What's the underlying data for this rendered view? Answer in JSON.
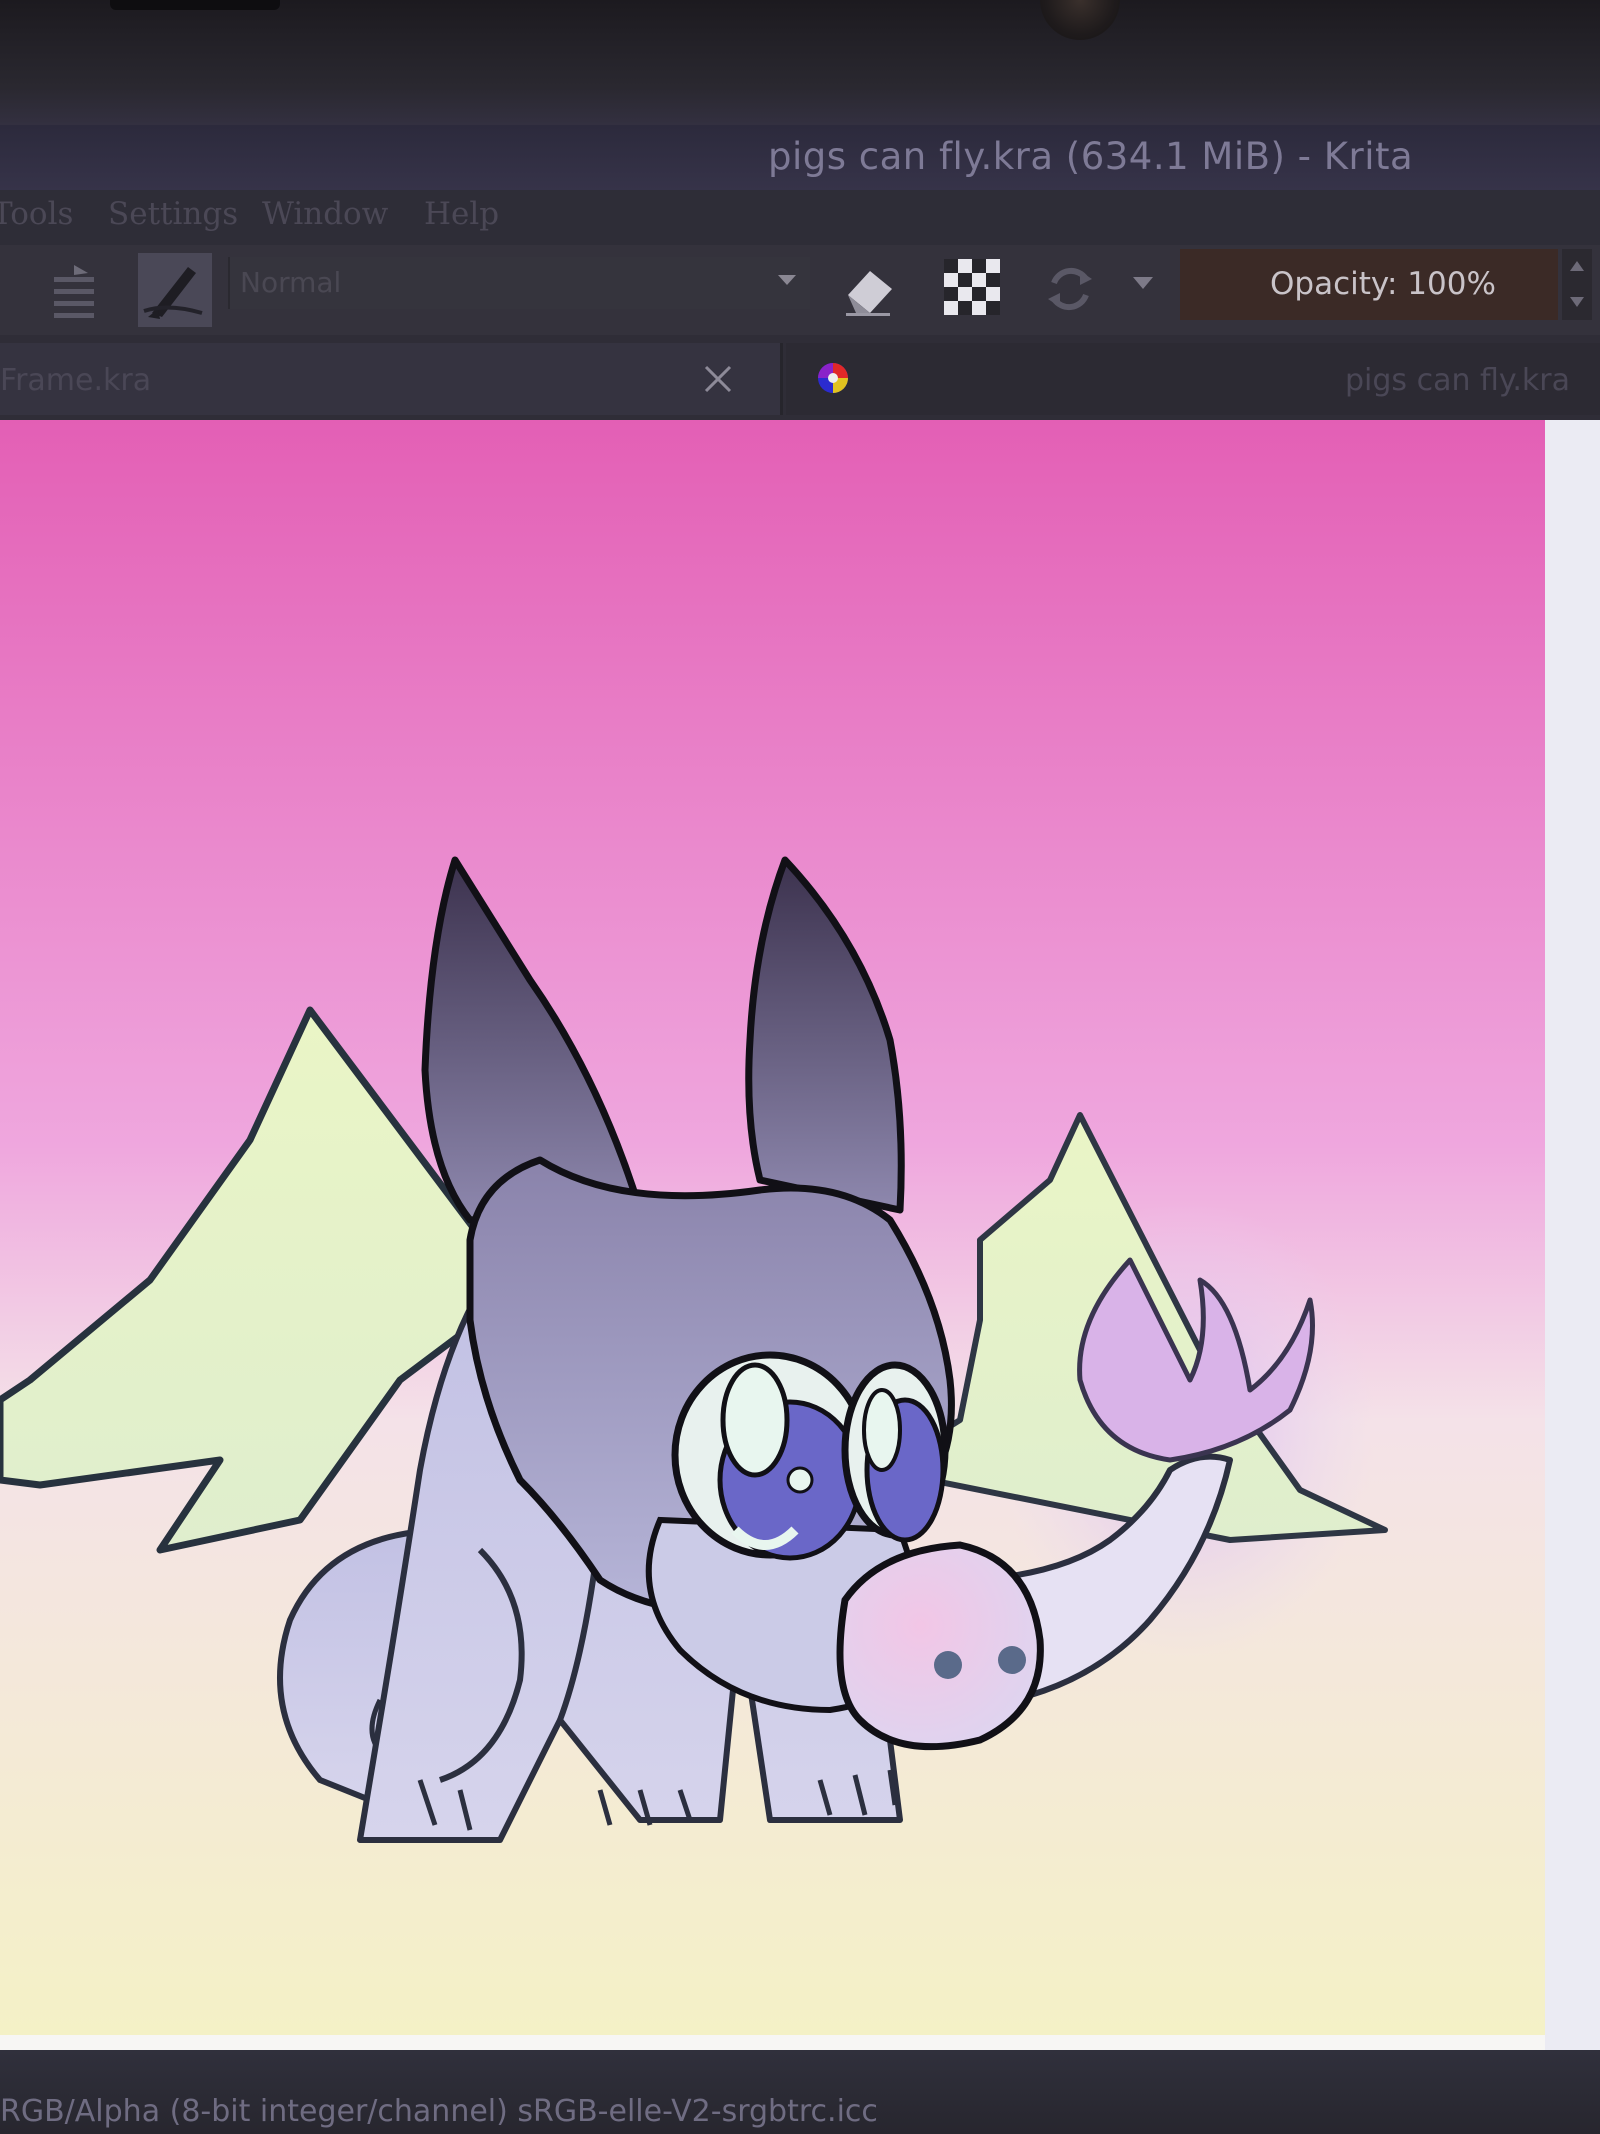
{
  "window": {
    "title": "pigs can fly.kra (634.1 MiB)  - Krita"
  },
  "menu": {
    "items": [
      "Tools",
      "Settings",
      "Window",
      "Help"
    ]
  },
  "toolbar": {
    "blend_mode": "Normal",
    "opacity_label": "Opacity: 100%",
    "icons": [
      "brush-presets-icon",
      "brush-editor-icon",
      "eraser-icon",
      "alpha-lock-icon",
      "reload-preset-icon",
      "dropdown-arrow-icon"
    ]
  },
  "tabs": [
    {
      "label": "Frame.kra"
    },
    {
      "label": "pigs can fly.kra"
    }
  ],
  "statusbar": {
    "color_profile": "RGB/Alpha (8-bit integer/channel)  sRGB-elle-V2-srgbtrc.icc"
  },
  "colors": {
    "accent_opacity": "#3b2a26",
    "canvas_top": "#e35fb5",
    "canvas_bottom": "#f4f1c8"
  }
}
